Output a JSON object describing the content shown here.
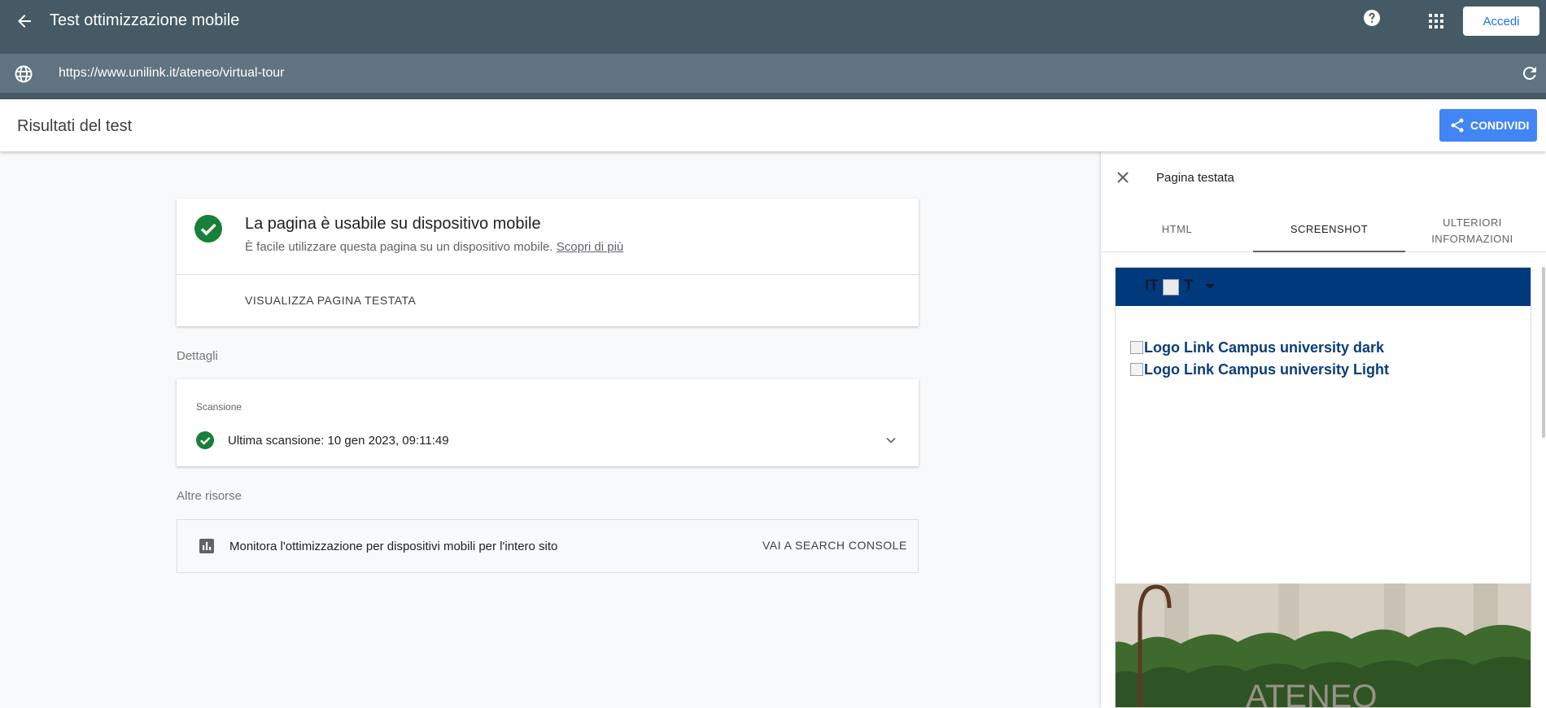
{
  "app": {
    "title": "Test ottimizzazione mobile",
    "signin_label": "Accedi"
  },
  "urlbar": {
    "url": "https://www.unilink.it/ateneo/virtual-tour"
  },
  "results": {
    "title": "Risultati del test",
    "share_label": "CONDIVIDI"
  },
  "main_card": {
    "headline": "La pagina è usabile su dispositivo mobile",
    "subtitle": "È facile utilizzare questa pagina su un dispositivo mobile.",
    "learn_more": "Scopri di più",
    "view_page_label": "VISUALIZZA PAGINA TESTATA"
  },
  "details": {
    "label": "Dettagli",
    "scan_label": "Scansione",
    "last_scan": "Ultima scansione: 10 gen 2023, 09:11:49"
  },
  "resources": {
    "label": "Altre risorse",
    "text": "Monitora l'ottimizzazione per dispositivi mobili per l'intero sito",
    "console_label": "VAI A SEARCH CONSOLE"
  },
  "panel": {
    "title": "Pagina testata",
    "tabs": [
      {
        "label": "HTML"
      },
      {
        "label": "SCREENSHOT",
        "active": true
      },
      {
        "label_line1": "ULTERIORI",
        "label_line2": "INFORMAZIONI"
      }
    ]
  },
  "preview": {
    "lang_label_left": "IT",
    "lang_label_right": "T",
    "logo_dark_alt": "Logo Link Campus university dark",
    "logo_light_alt": "Logo Link Campus university Light",
    "photo_caption": "ATENEO"
  },
  "colors": {
    "header_bg": "#455a64",
    "urlbar_bg": "#5f7480",
    "accent_blue": "#4285f4",
    "success_green": "#188038",
    "preview_nav_bg": "#003a7d"
  },
  "icons": {
    "back": "arrow-left-icon",
    "help": "help-circle-icon",
    "apps": "apps-grid-icon",
    "globe": "globe-icon",
    "reload": "reload-icon",
    "share": "share-icon",
    "check": "check-circle-icon",
    "chevron": "chevron-down-icon",
    "chart": "bar-chart-icon",
    "close": "close-icon"
  }
}
